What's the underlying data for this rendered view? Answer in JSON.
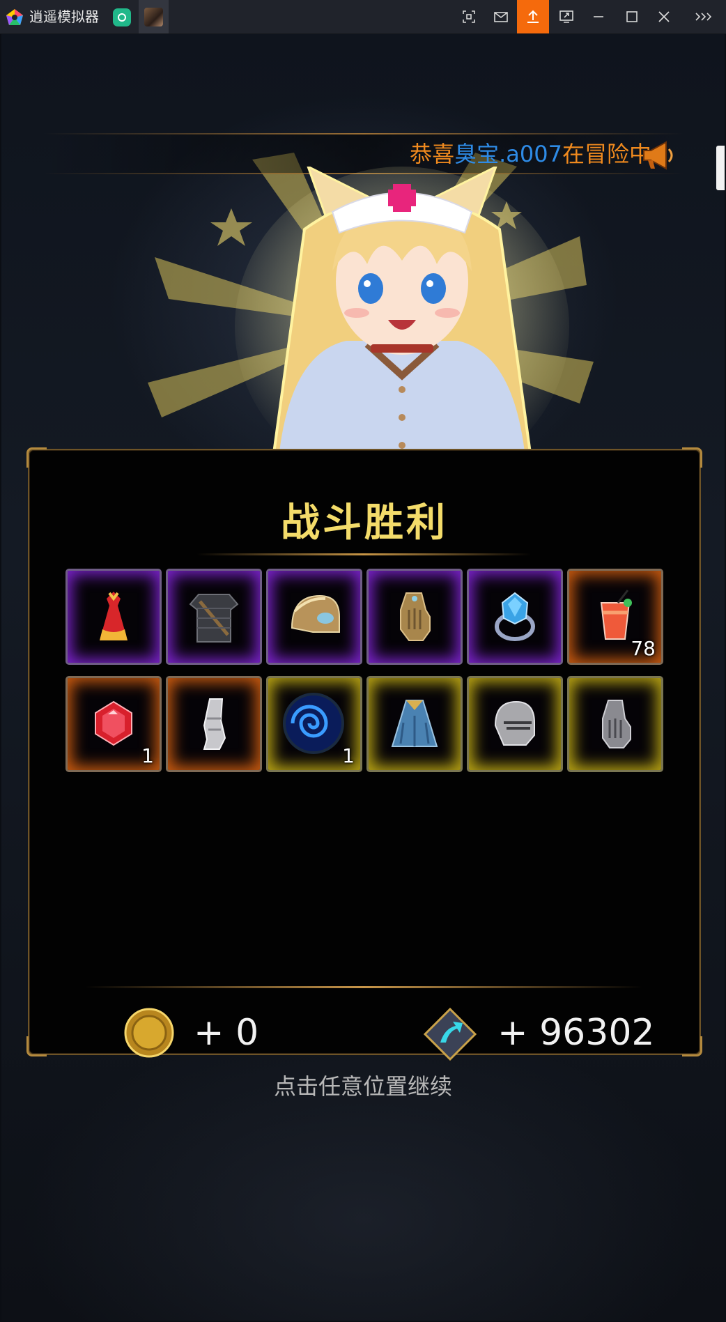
{
  "window": {
    "app_title": "逍遥模拟器",
    "icons": [
      "pentagon-logo-icon",
      "app-tab-icon",
      "game-tab-icon",
      "screenshot-icon",
      "mail-icon",
      "upload-icon",
      "screen-share-icon",
      "minimize-icon",
      "maximize-icon",
      "close-icon",
      "more-icon"
    ],
    "accent": "#f56a0c"
  },
  "notice": {
    "prefix": "恭喜",
    "player": "臭宝.a007",
    "suffix": "在冒险中",
    "colors": {
      "text": "#f08a1e",
      "player": "#2e8be6"
    }
  },
  "panel": {
    "title": "战斗胜利",
    "items_row1": [
      {
        "name": "red-robe-icon",
        "rarity": "purple",
        "count": ""
      },
      {
        "name": "chainmail-armor-icon",
        "rarity": "purple",
        "count": ""
      },
      {
        "name": "golden-helmet-icon",
        "rarity": "purple",
        "count": ""
      },
      {
        "name": "golden-gauntlet-icon",
        "rarity": "purple",
        "count": ""
      },
      {
        "name": "sapphire-ring-icon",
        "rarity": "purple",
        "count": ""
      },
      {
        "name": "red-drink-icon",
        "rarity": "orange",
        "count": "78"
      }
    ],
    "items_row2": [
      {
        "name": "ruby-gem-icon",
        "rarity": "orange",
        "count": "1"
      },
      {
        "name": "steel-boot-icon",
        "rarity": "orange",
        "count": ""
      },
      {
        "name": "blue-vortex-orb-icon",
        "rarity": "yellow",
        "count": "1"
      },
      {
        "name": "blue-cloak-icon",
        "rarity": "yellow",
        "count": ""
      },
      {
        "name": "knight-helm-icon",
        "rarity": "yellow",
        "count": ""
      },
      {
        "name": "iron-gauntlet-icon",
        "rarity": "yellow",
        "count": ""
      }
    ],
    "rewards": {
      "gold": "+ 0",
      "exp": "+ 96302"
    }
  },
  "continue_hint": "点击任意位置继续"
}
